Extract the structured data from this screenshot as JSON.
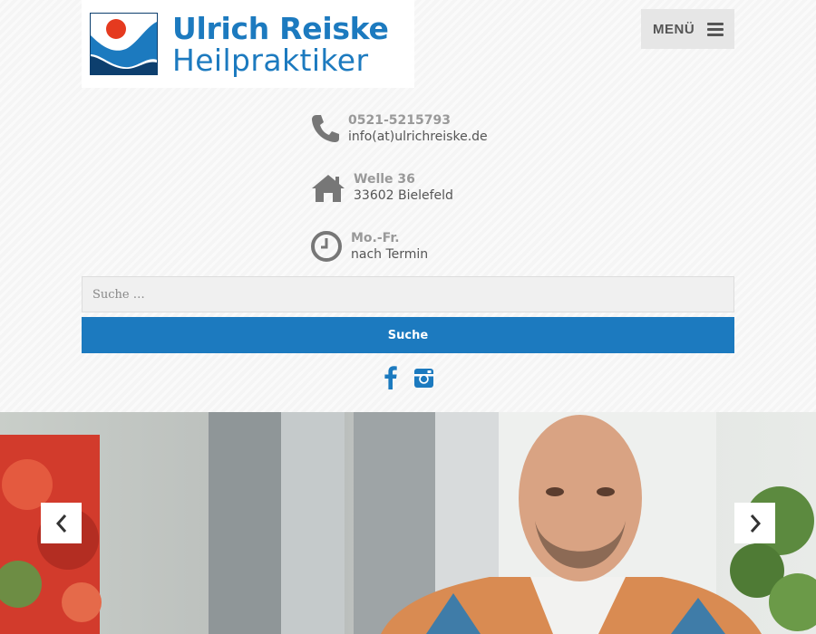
{
  "header": {
    "logo_name": "Ulrich Reiske",
    "logo_subtitle": "Heilpraktiker",
    "menu_label": "MENÜ"
  },
  "contact": [
    {
      "icon": "phone-icon",
      "line1": "0521-5215793",
      "line2": "info(at)ulrichreiske.de"
    },
    {
      "icon": "home-icon",
      "line1": "Welle 36",
      "line2": "33602 Bielefeld"
    },
    {
      "icon": "clock-icon",
      "line1": "Mo.-Fr.",
      "line2": "nach Termin"
    }
  ],
  "search": {
    "placeholder": "Suche …",
    "value": "",
    "button_label": "Suche"
  },
  "social": [
    "facebook-icon",
    "instagram-icon"
  ],
  "slider": {
    "prev_icon": "chevron-left-icon",
    "next_icon": "chevron-right-icon"
  },
  "colors": {
    "brand_blue": "#1c7abf",
    "logo_red": "#e53a1f",
    "logo_dark_blue": "#0d3f6e"
  }
}
